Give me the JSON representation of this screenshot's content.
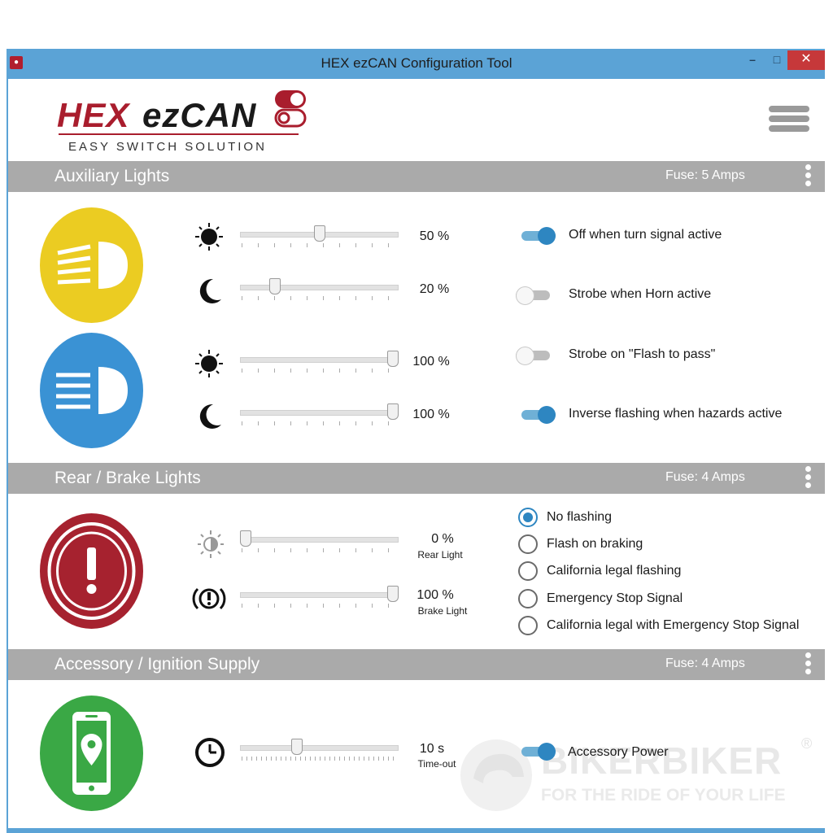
{
  "window": {
    "title": "HEX ezCAN Configuration Tool",
    "minimize": "–",
    "maximize": "□",
    "close": "✕"
  },
  "header": {
    "logo_hex": "HEX",
    "logo_ezcan": "ezCAN",
    "tagline": "EASY SWITCH SOLUTION",
    "menu_icon": "hamburger-icon"
  },
  "sections": {
    "auxiliary": {
      "title": "Auxiliary Lights",
      "fuse": "Fuse: 5 Amps",
      "light1": {
        "day_value": "50 %",
        "night_value": "20 %",
        "day_level": 0.5,
        "night_level": 0.2
      },
      "light2": {
        "day_value": "100 %",
        "night_value": "100 %",
        "day_level": 1.0,
        "night_level": 1.0
      },
      "options": [
        {
          "label": "Off when turn signal active",
          "on": true
        },
        {
          "label": "Strobe when Horn active",
          "on": false
        },
        {
          "label": "Strobe on \"Flash to pass\"",
          "on": false
        },
        {
          "label": "Inverse flashing when hazards active",
          "on": true
        }
      ],
      "colors": {
        "light1": "#ebcc22",
        "light2": "#3a92d4"
      }
    },
    "rear": {
      "title": "Rear / Brake Lights",
      "fuse": "Fuse: 4 Amps",
      "rear_value": "0 %",
      "rear_label": "Rear Light",
      "rear_level": 0.0,
      "brake_value": "100 %",
      "brake_label": "Brake Light",
      "brake_level": 1.0,
      "options": [
        {
          "label": "No flashing",
          "selected": true
        },
        {
          "label": "Flash on braking",
          "selected": false
        },
        {
          "label": "California legal flashing",
          "selected": false
        },
        {
          "label": "Emergency Stop Signal",
          "selected": false
        },
        {
          "label": "California legal with Emergency Stop Signal",
          "selected": false
        }
      ],
      "color": "#a6222f"
    },
    "accessory": {
      "title": "Accessory / Ignition Supply",
      "fuse": "Fuse: 4 Amps",
      "timeout_value": "10 s",
      "timeout_label": "Time-out",
      "timeout_level": 0.35,
      "option": {
        "label": "Accessory Power",
        "on": true
      },
      "color": "#3aa845"
    }
  },
  "watermark": {
    "brand": "BIKERBIKER",
    "registered": "®",
    "slogan": "FOR THE RIDE OF YOUR LIFE"
  }
}
